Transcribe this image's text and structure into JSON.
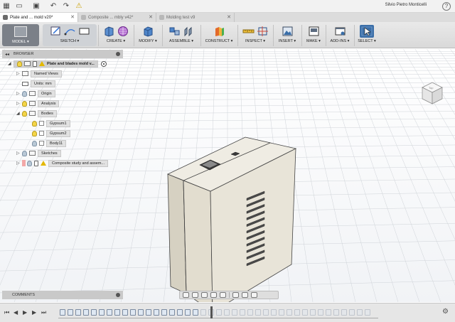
{
  "app": {
    "user_name": "Silvio Pietro Monticelli",
    "help_label": "?"
  },
  "quick_access": {
    "icons": [
      "grid-icon",
      "file-icon",
      "save-icon",
      "undo-icon",
      "redo-icon",
      "warning-icon"
    ]
  },
  "tabs": [
    {
      "label": "Plate and ... mold v20*",
      "active": true
    },
    {
      "label": "Composite ... mbly v42*",
      "active": false
    },
    {
      "label": "Molding test v9",
      "active": false
    }
  ],
  "toolbar": {
    "workspace_label": "MODEL ▾",
    "groups": [
      {
        "label": "SKETCH ▾"
      },
      {
        "label": "CREATE ▾"
      },
      {
        "label": "MODIFY ▾"
      },
      {
        "label": "ASSEMBLE ▾"
      },
      {
        "label": "CONSTRUCT ▾"
      },
      {
        "label": "INSPECT ▾"
      },
      {
        "label": "INSERT ▾"
      },
      {
        "label": "MAKE ▾"
      },
      {
        "label": "ADD-INS ▾"
      },
      {
        "label": "SELECT ▾"
      }
    ]
  },
  "browser": {
    "title": "BROWSER",
    "root_label": "Plate and blades mold v...",
    "items": [
      {
        "label": "Named Views"
      },
      {
        "label": "Units: mm"
      },
      {
        "label": "Origin"
      },
      {
        "label": "Analysis"
      },
      {
        "label": "Bodies"
      },
      {
        "label": "Gypsum1"
      },
      {
        "label": "Gypsum2"
      },
      {
        "label": "Body11"
      },
      {
        "label": "Sketches"
      },
      {
        "label": "Composite study and assem..."
      }
    ]
  },
  "viewcube": {
    "face_label": "Top"
  },
  "comments": {
    "title": "COMMENTS"
  },
  "colors": {
    "body_face": "#e8e4d8",
    "body_side": "#d6d1c2",
    "toolbar_active": "#3c6fa8",
    "warning": "#e3b800"
  }
}
